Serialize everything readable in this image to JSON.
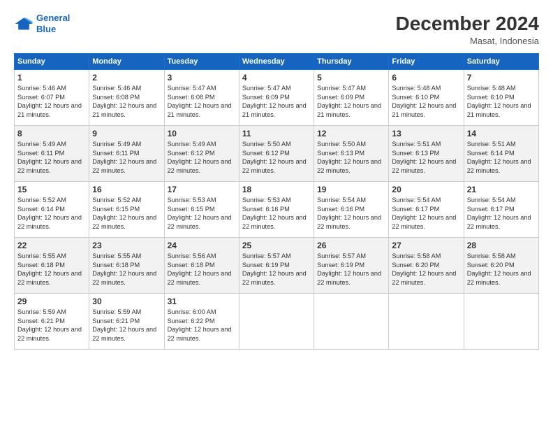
{
  "logo": {
    "line1": "General",
    "line2": "Blue"
  },
  "header": {
    "title": "December 2024",
    "location": "Masat, Indonesia"
  },
  "weekdays": [
    "Sunday",
    "Monday",
    "Tuesday",
    "Wednesday",
    "Thursday",
    "Friday",
    "Saturday"
  ],
  "weeks": [
    [
      {
        "day": 1,
        "sunrise": "5:46 AM",
        "sunset": "6:07 PM",
        "daylight": "12 hours and 21 minutes."
      },
      {
        "day": 2,
        "sunrise": "5:46 AM",
        "sunset": "6:08 PM",
        "daylight": "12 hours and 21 minutes."
      },
      {
        "day": 3,
        "sunrise": "5:47 AM",
        "sunset": "6:08 PM",
        "daylight": "12 hours and 21 minutes."
      },
      {
        "day": 4,
        "sunrise": "5:47 AM",
        "sunset": "6:09 PM",
        "daylight": "12 hours and 21 minutes."
      },
      {
        "day": 5,
        "sunrise": "5:47 AM",
        "sunset": "6:09 PM",
        "daylight": "12 hours and 21 minutes."
      },
      {
        "day": 6,
        "sunrise": "5:48 AM",
        "sunset": "6:10 PM",
        "daylight": "12 hours and 21 minutes."
      },
      {
        "day": 7,
        "sunrise": "5:48 AM",
        "sunset": "6:10 PM",
        "daylight": "12 hours and 21 minutes."
      }
    ],
    [
      {
        "day": 8,
        "sunrise": "5:49 AM",
        "sunset": "6:11 PM",
        "daylight": "12 hours and 22 minutes."
      },
      {
        "day": 9,
        "sunrise": "5:49 AM",
        "sunset": "6:11 PM",
        "daylight": "12 hours and 22 minutes."
      },
      {
        "day": 10,
        "sunrise": "5:49 AM",
        "sunset": "6:12 PM",
        "daylight": "12 hours and 22 minutes."
      },
      {
        "day": 11,
        "sunrise": "5:50 AM",
        "sunset": "6:12 PM",
        "daylight": "12 hours and 22 minutes."
      },
      {
        "day": 12,
        "sunrise": "5:50 AM",
        "sunset": "6:13 PM",
        "daylight": "12 hours and 22 minutes."
      },
      {
        "day": 13,
        "sunrise": "5:51 AM",
        "sunset": "6:13 PM",
        "daylight": "12 hours and 22 minutes."
      },
      {
        "day": 14,
        "sunrise": "5:51 AM",
        "sunset": "6:14 PM",
        "daylight": "12 hours and 22 minutes."
      }
    ],
    [
      {
        "day": 15,
        "sunrise": "5:52 AM",
        "sunset": "6:14 PM",
        "daylight": "12 hours and 22 minutes."
      },
      {
        "day": 16,
        "sunrise": "5:52 AM",
        "sunset": "6:15 PM",
        "daylight": "12 hours and 22 minutes."
      },
      {
        "day": 17,
        "sunrise": "5:53 AM",
        "sunset": "6:15 PM",
        "daylight": "12 hours and 22 minutes."
      },
      {
        "day": 18,
        "sunrise": "5:53 AM",
        "sunset": "6:16 PM",
        "daylight": "12 hours and 22 minutes."
      },
      {
        "day": 19,
        "sunrise": "5:54 AM",
        "sunset": "6:16 PM",
        "daylight": "12 hours and 22 minutes."
      },
      {
        "day": 20,
        "sunrise": "5:54 AM",
        "sunset": "6:17 PM",
        "daylight": "12 hours and 22 minutes."
      },
      {
        "day": 21,
        "sunrise": "5:54 AM",
        "sunset": "6:17 PM",
        "daylight": "12 hours and 22 minutes."
      }
    ],
    [
      {
        "day": 22,
        "sunrise": "5:55 AM",
        "sunset": "6:18 PM",
        "daylight": "12 hours and 22 minutes."
      },
      {
        "day": 23,
        "sunrise": "5:55 AM",
        "sunset": "6:18 PM",
        "daylight": "12 hours and 22 minutes."
      },
      {
        "day": 24,
        "sunrise": "5:56 AM",
        "sunset": "6:18 PM",
        "daylight": "12 hours and 22 minutes."
      },
      {
        "day": 25,
        "sunrise": "5:57 AM",
        "sunset": "6:19 PM",
        "daylight": "12 hours and 22 minutes."
      },
      {
        "day": 26,
        "sunrise": "5:57 AM",
        "sunset": "6:19 PM",
        "daylight": "12 hours and 22 minutes."
      },
      {
        "day": 27,
        "sunrise": "5:58 AM",
        "sunset": "6:20 PM",
        "daylight": "12 hours and 22 minutes."
      },
      {
        "day": 28,
        "sunrise": "5:58 AM",
        "sunset": "6:20 PM",
        "daylight": "12 hours and 22 minutes."
      }
    ],
    [
      {
        "day": 29,
        "sunrise": "5:59 AM",
        "sunset": "6:21 PM",
        "daylight": "12 hours and 22 minutes."
      },
      {
        "day": 30,
        "sunrise": "5:59 AM",
        "sunset": "6:21 PM",
        "daylight": "12 hours and 22 minutes."
      },
      {
        "day": 31,
        "sunrise": "6:00 AM",
        "sunset": "6:22 PM",
        "daylight": "12 hours and 22 minutes."
      },
      null,
      null,
      null,
      null
    ]
  ]
}
